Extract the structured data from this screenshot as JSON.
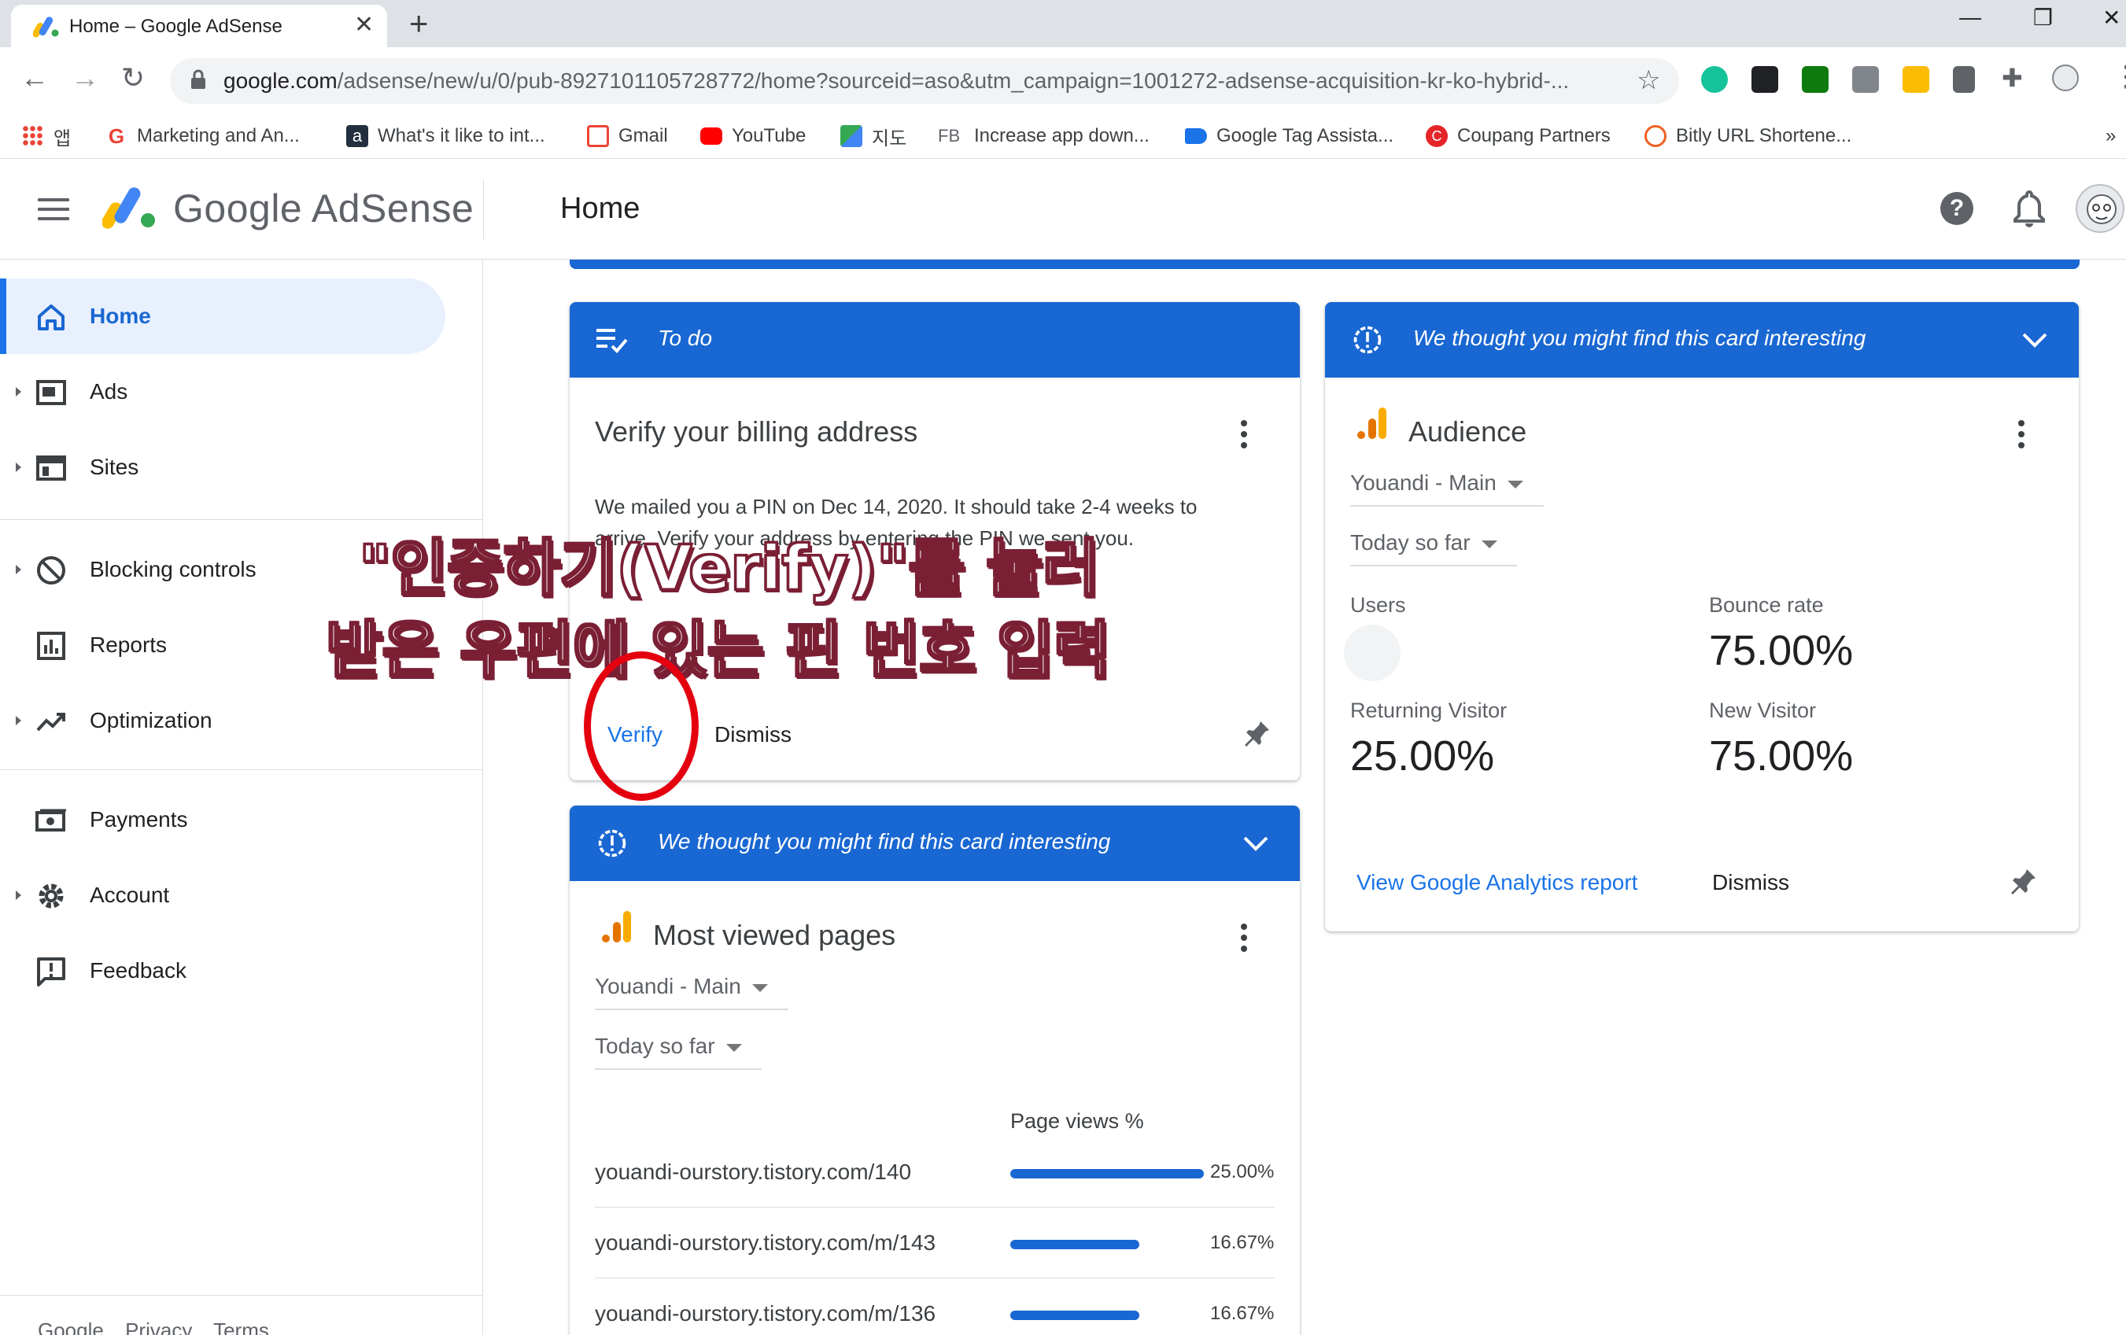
{
  "browser": {
    "tab_title": "Home – Google AdSense",
    "tab_close": "✕",
    "new_tab": "+",
    "url_host": "google.com",
    "url_path": "/adsense/new/u/0/pub-8927101105728772/home?sourceid=aso&utm_campaign=1001272-adsense-acquisition-kr-ko-hybrid-...",
    "window_controls": [
      "—",
      "❐",
      "✕"
    ],
    "bookmarks": [
      {
        "label": "앱",
        "icon": "apps-grid-icon",
        "color": "#ea4335"
      },
      {
        "label": "Marketing and An...",
        "icon": "google-g-icon",
        "color": "#ea4335"
      },
      {
        "label": "What's it like to int...",
        "icon": "amazon-icon",
        "color": "#232f3e"
      },
      {
        "label": "Gmail",
        "icon": "gmail-icon",
        "color": "#ea4335"
      },
      {
        "label": "YouTube",
        "icon": "youtube-icon",
        "color": "#ff0000"
      },
      {
        "label": "지도",
        "icon": "maps-icon",
        "color": "#34a853"
      },
      {
        "label": "Increase app down...",
        "icon": "fb-text-icon",
        "color": "#5f6368"
      },
      {
        "label": "Google Tag Assista...",
        "icon": "tag-icon",
        "color": "#1a73e8"
      },
      {
        "label": "Coupang Partners",
        "icon": "coupang-icon",
        "color": "#e52528"
      },
      {
        "label": "Bitly URL Shortene...",
        "icon": "bitly-icon",
        "color": "#ee6123"
      }
    ],
    "bookmarks_more": "»"
  },
  "header": {
    "brand": "Google AdSense",
    "page_title": "Home",
    "help": "?"
  },
  "sidebar": {
    "items": [
      {
        "label": "Home",
        "icon": "home-icon",
        "active": true
      },
      {
        "label": "Ads",
        "icon": "ads-icon"
      },
      {
        "label": "Sites",
        "icon": "sites-icon"
      },
      {
        "label": "Blocking controls",
        "icon": "block-icon"
      },
      {
        "label": "Reports",
        "icon": "reports-icon"
      },
      {
        "label": "Optimization",
        "icon": "trend-icon"
      },
      {
        "label": "Payments",
        "icon": "payments-icon"
      },
      {
        "label": "Account",
        "icon": "gear-icon"
      },
      {
        "label": "Feedback",
        "icon": "feedback-icon"
      }
    ],
    "footer": [
      "Google",
      "Privacy",
      "Terms"
    ]
  },
  "todo_card": {
    "header": "To do",
    "title": "Verify your billing address",
    "body_line1": "We mailed you a PIN on Dec 14, 2020. It should take 2-4 weeks to",
    "body_line2": "arrive. Verify your address by entering the PIN we sent you.",
    "verify": "Verify",
    "dismiss": "Dismiss"
  },
  "pages_card": {
    "header": "We thought you might find this card interesting",
    "title": "Most viewed pages",
    "property": "Youandi - Main",
    "range": "Today so far",
    "column": "Page views %",
    "rows": [
      {
        "url": "youandi-ourstory.tistory.com/140",
        "pct": "25.00%",
        "value": 25.0
      },
      {
        "url": "youandi-ourstory.tistory.com/m/143",
        "pct": "16.67%",
        "value": 16.67
      },
      {
        "url": "youandi-ourstory.tistory.com/m/136",
        "pct": "16.67%",
        "value": 16.67
      }
    ]
  },
  "audience_card": {
    "header": "We thought you might find this card interesting",
    "title": "Audience",
    "property": "Youandi - Main",
    "range": "Today so far",
    "users_label": "Users",
    "bounce_label": "Bounce rate",
    "bounce_value": "75.00%",
    "returning_label": "Returning Visitor",
    "returning_value": "25.00%",
    "new_label": "New Visitor",
    "new_value": "75.00%",
    "view_report": "View Google Analytics report",
    "dismiss": "Dismiss"
  },
  "annotation": {
    "line1": "\"인증하기(Verify)\"를 눌러",
    "line2": "받은 우편에 있는 핀 번호 입력"
  },
  "colors": {
    "card_header": "#1967d2",
    "link": "#1a73e8",
    "active_nav_bg": "#e8f0fe",
    "annotation_circle": "#e4000f"
  }
}
